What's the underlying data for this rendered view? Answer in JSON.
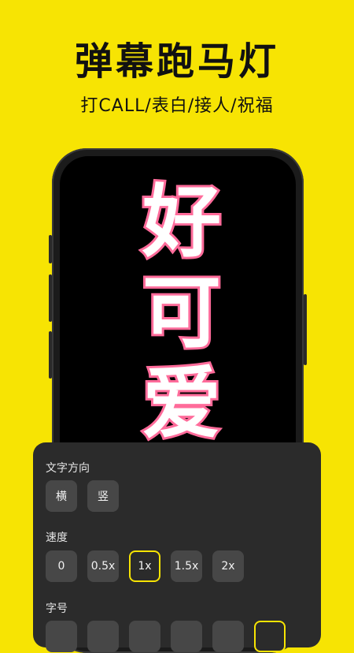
{
  "headline": "弹幕跑马灯",
  "subline": "打CALL/表白/接人/祝福",
  "marquee": {
    "text": "好可爱",
    "color": "#ff6b9a",
    "glyph_color": "#ff6b9a"
  },
  "panel": {
    "direction": {
      "label": "文字方向",
      "options": [
        "横",
        "竖"
      ]
    },
    "speed": {
      "label": "速度",
      "options": [
        "0",
        "0.5x",
        "1x",
        "1.5x",
        "2x"
      ],
      "selected": "1x"
    },
    "font_size": {
      "label": "字号"
    }
  },
  "colors": {
    "background": "#f7e403",
    "accent": "#f7e403",
    "panel": "#2b2b2b",
    "chip": "#474747"
  }
}
